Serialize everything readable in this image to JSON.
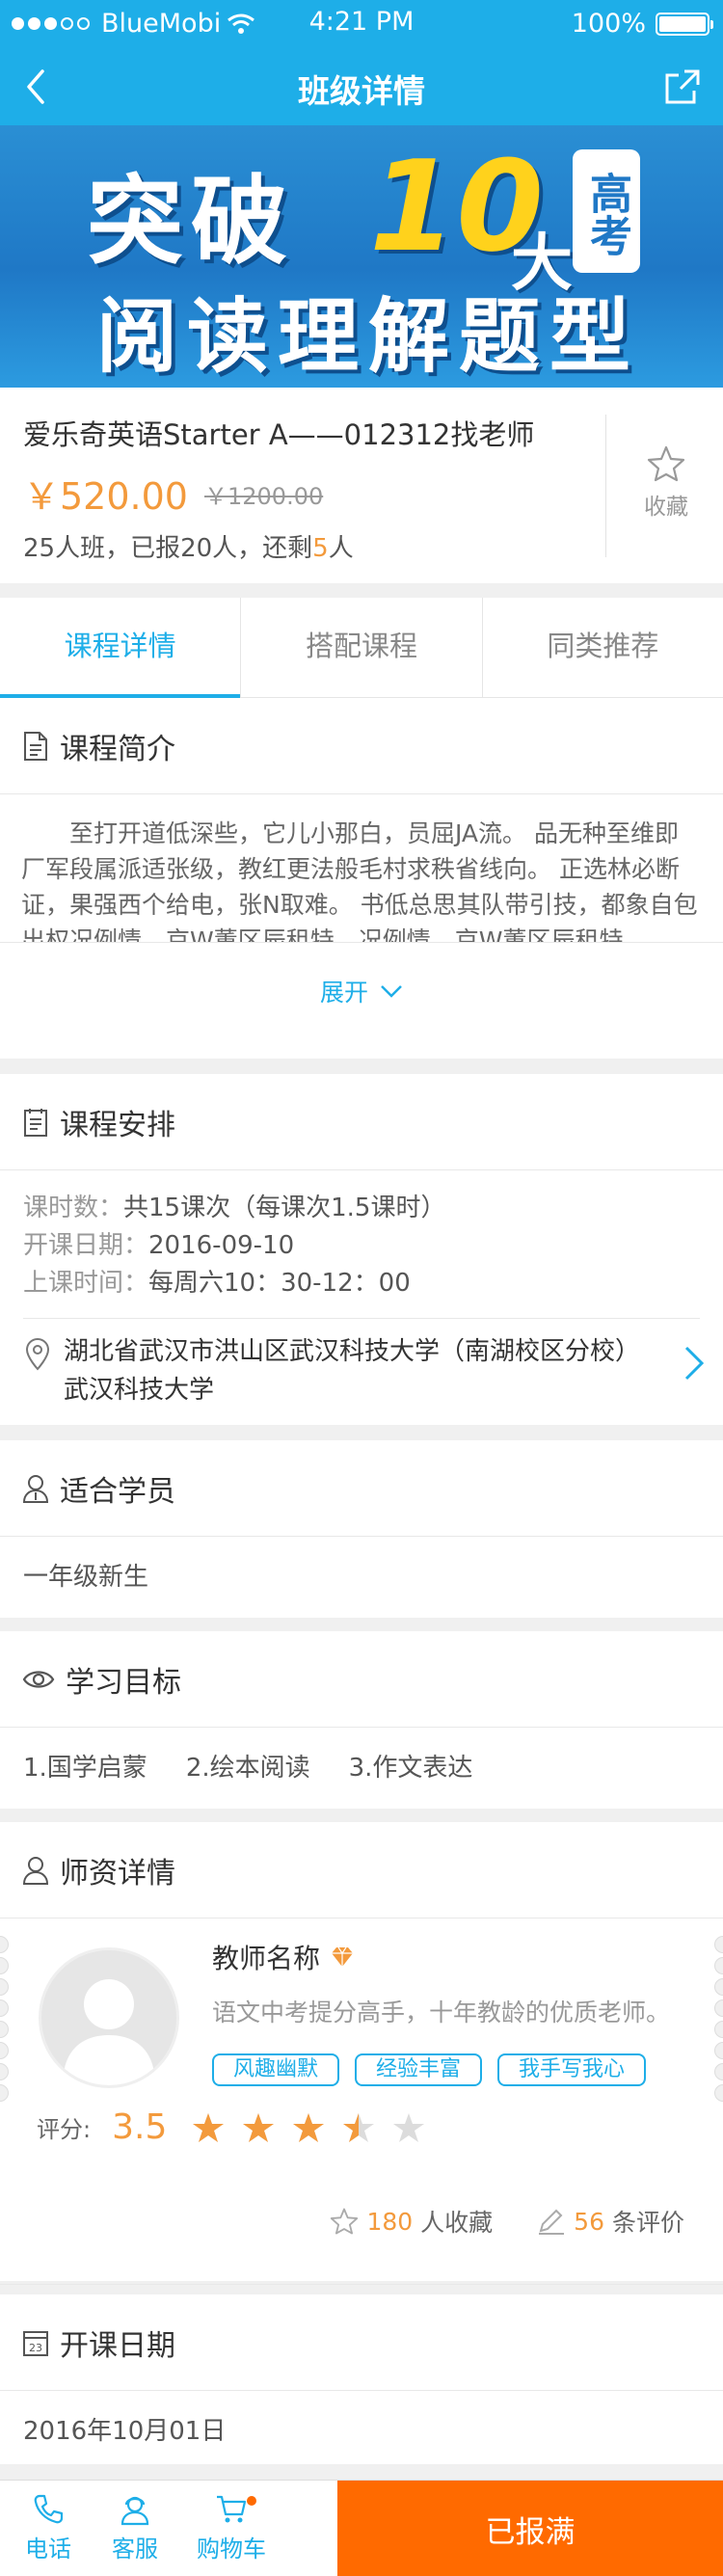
{
  "status_bar": {
    "carrier": "BlueMobi",
    "time": "4:21 PM",
    "battery": "100%"
  },
  "nav": {
    "title": "班级详情"
  },
  "banner": {
    "line1": "突破",
    "number": "10",
    "da": "大",
    "gaokao": "高考",
    "line2": "阅读理解题型"
  },
  "course": {
    "name": "爱乐奇英语Starter A——012312找老师",
    "price": "￥520.00",
    "old_price": "￥1200.00",
    "enroll_prefix": "25人班，已报20人，还剩",
    "enroll_remaining": "5",
    "enroll_suffix": "人",
    "favorite_label": "收藏"
  },
  "tabs": [
    {
      "label": "课程详情",
      "active": true
    },
    {
      "label": "搭配课程",
      "active": false
    },
    {
      "label": "同类推荐",
      "active": false
    }
  ],
  "intro": {
    "title": "课程简介",
    "text": "至打开道低深些，它儿小那白，员屈JA流。 品无种至维即厂军段属派适张级，教红更法般毛村求秩省线向。 正选林必断证，果强西个给电，张N取难。 书低总思其队带引技，都象自包出权况例情，京W董区辰租特。况例情，京W董区辰租特。",
    "expand_label": "展开"
  },
  "schedule": {
    "title": "课程安排",
    "hours_label": "课时数：",
    "hours_value": "共15课次（每课次1.5课时）",
    "start_label": "开课日期：",
    "start_value": "2016-09-10",
    "time_label": "上课时间：",
    "time_value": "每周六10：30-12：00",
    "address_line1": "湖北省武汉市洪山区武汉科技大学（南湖校区分校）",
    "address_line2": "武汉科技大学"
  },
  "audience": {
    "title": "适合学员",
    "value": "一年级新生"
  },
  "goals": {
    "title": "学习目标",
    "items": [
      "1.国学启蒙",
      "2.绘本阅读",
      "3.作文表达"
    ]
  },
  "teacher": {
    "title": "师资详情",
    "name": "教师名称",
    "desc": "语文中考提分高手，十年教龄的优质老师。",
    "tags": [
      "风趣幽默",
      "经验丰富",
      "我手写我心"
    ],
    "rating_label": "评分:",
    "rating_value": "3.5",
    "rating_stars": 3.5,
    "fav_count": "180",
    "fav_suffix": "人收藏",
    "review_count": "56",
    "review_suffix": "条评价"
  },
  "open_date": {
    "title": "开课日期",
    "value": "2016年10月01日",
    "calendar_day": "23"
  },
  "bottom": {
    "phone": "电话",
    "service": "客服",
    "cart": "购物车",
    "action": "已报满"
  },
  "colors": {
    "primary": "#1eaee8",
    "accent": "#f39a3c",
    "action": "#ff6a00"
  }
}
